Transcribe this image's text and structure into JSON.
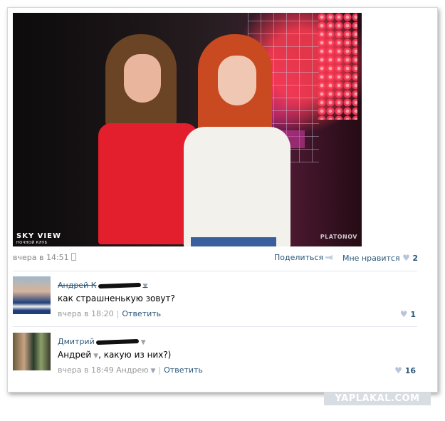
{
  "photo": {
    "watermark_left": "SKY VIEW",
    "watermark_left_sub": "НОЧНОЙ КЛУБ",
    "watermark_right": "PLATONOV"
  },
  "post": {
    "timestamp": "вчера в 14:51",
    "share_label": "Поделиться",
    "like_label": "Мне нравится",
    "like_count": "2"
  },
  "comments": [
    {
      "author": "Андрей К",
      "text": "как страшненькую зовут?",
      "time": "вчера в 18:20",
      "reply_label": "Ответить",
      "likes": "1"
    },
    {
      "author": "Дмитрий",
      "text_prefix": "Андрей",
      "text_suffix": ", какую из них?)",
      "time": "вчера в 18:49",
      "reply_to": "Андрею",
      "reply_label": "Ответить",
      "likes": "16"
    }
  ],
  "site_watermark": "YAPLAKAL.COM",
  "colors": {
    "link": "#2b587a",
    "meta": "#888888",
    "heart": "#b7c6d8"
  }
}
